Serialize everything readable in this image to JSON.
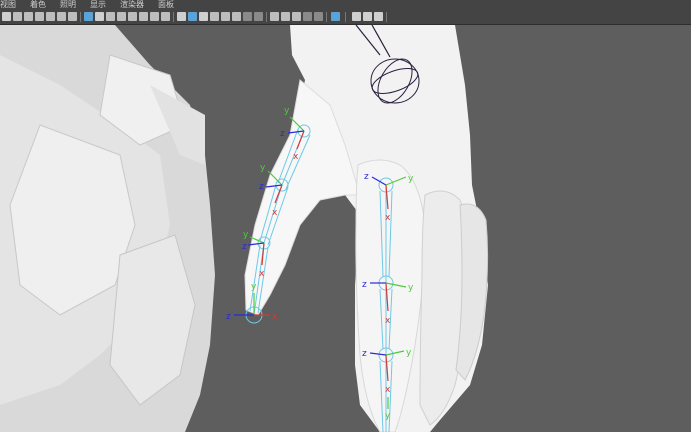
{
  "menu": {
    "items": [
      "视图",
      "着色",
      "照明",
      "显示",
      "渲染器",
      "面板"
    ]
  },
  "toolbar": {
    "icons": [
      "camera-icon",
      "camera-attributes-icon",
      "bookmark-icon",
      "image-plane-icon",
      "grid-icon",
      "2d-pan-zoom-icon",
      "grease-pencil-icon",
      "wireframe-icon",
      "smooth-shade-icon",
      "bounding-box-icon",
      "flat-shade-icon",
      "resolution-gate-icon",
      "gate-mask-icon",
      "field-chart-icon",
      "safe-action-icon",
      "isolate-select-icon",
      "xray-icon",
      "xray-joints-icon",
      "default-material-icon",
      "textures-icon",
      "lights-icon",
      "shadows-icon",
      "ambient-occlusion-icon",
      "motion-blur-icon",
      "anti-alias-icon",
      "depth-of-field-icon",
      "exposure-icon",
      "gamma-icon",
      "color-management-icon"
    ],
    "accent_color": "#5aa3d9"
  },
  "viewport": {
    "background_color": "#5e5e5e",
    "joint_color": "#6ec8e6",
    "axis_labels": {
      "x": "x",
      "y": "y",
      "z": "z"
    },
    "axis_colors": {
      "x": "#d23a3a",
      "y": "#4ecb3c",
      "z": "#2a2ad8"
    }
  }
}
